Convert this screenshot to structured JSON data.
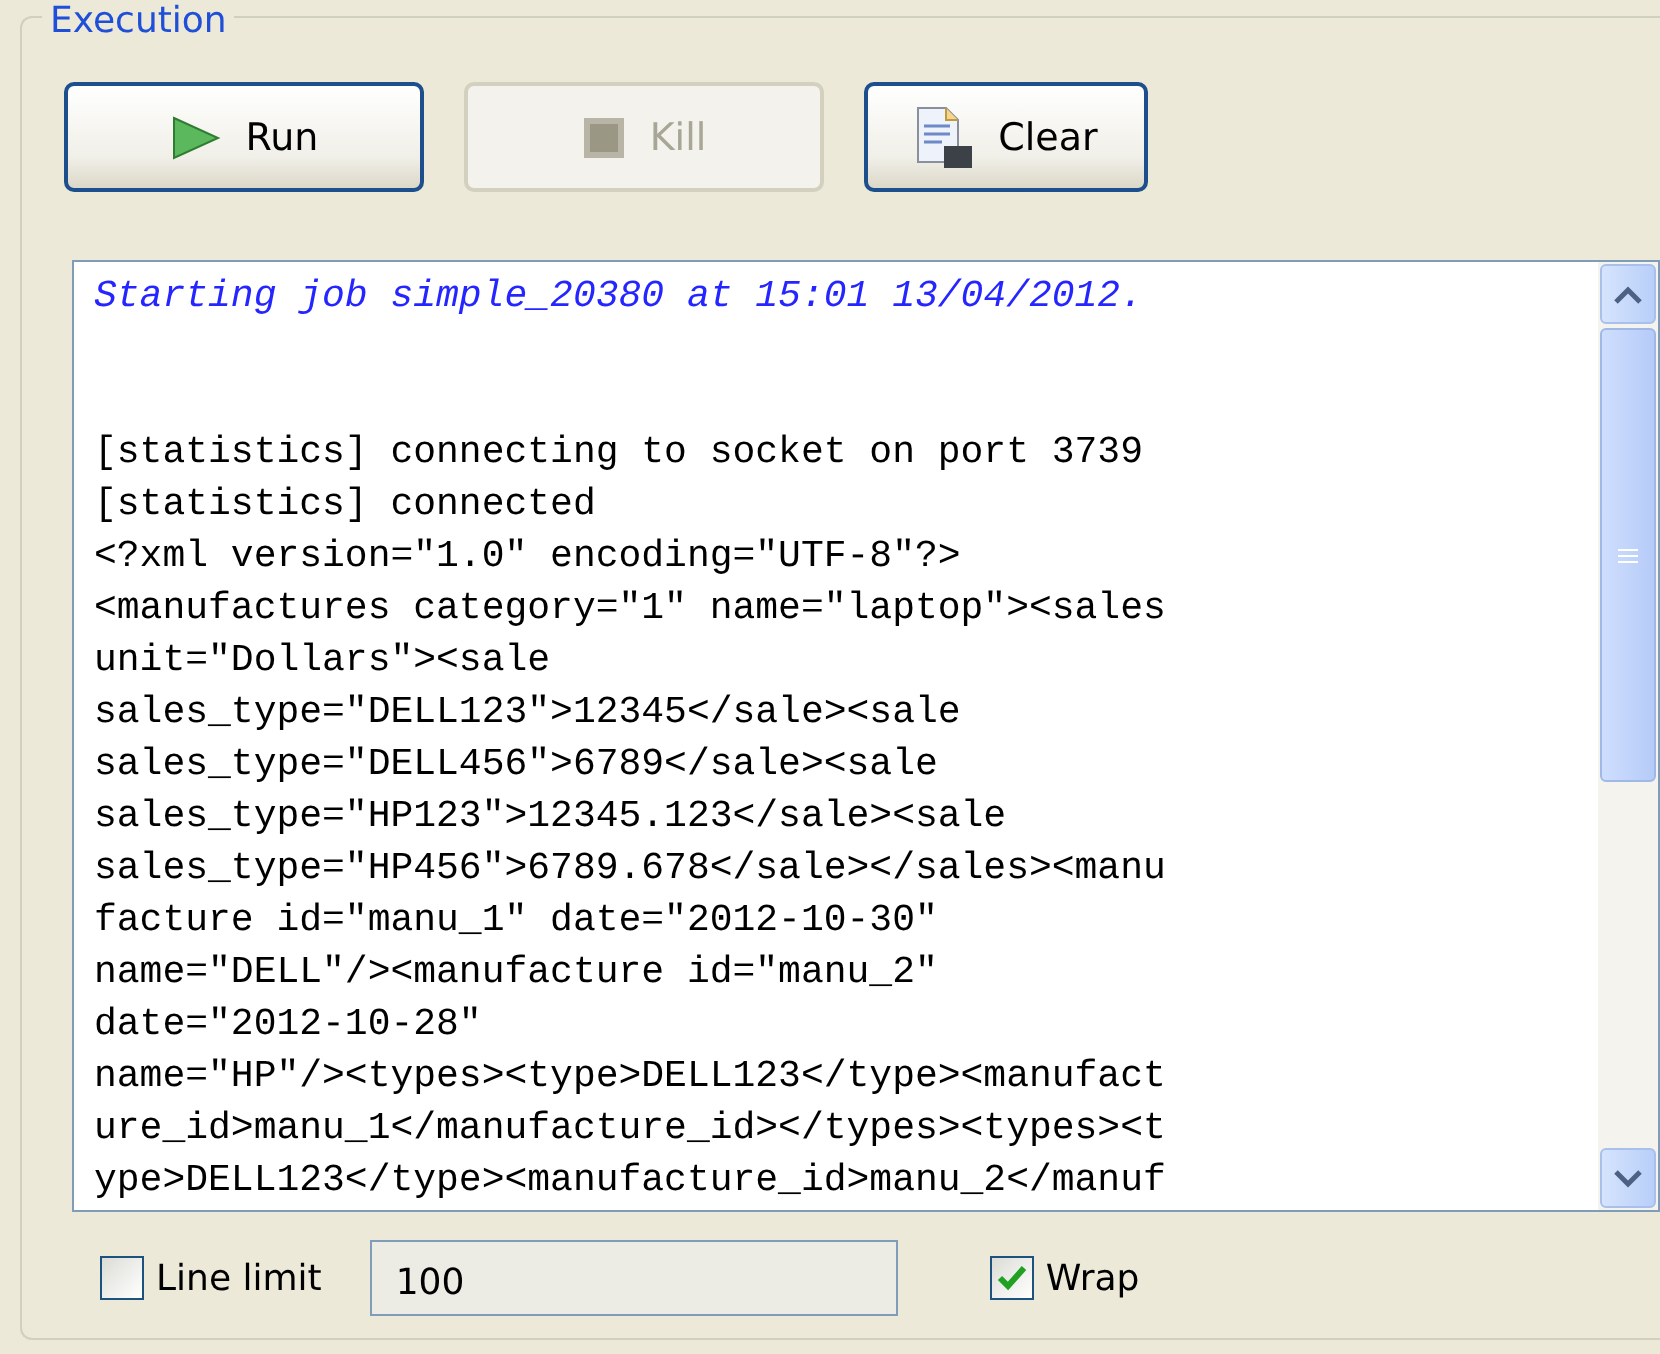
{
  "group": {
    "title": "Execution"
  },
  "buttons": [
    {
      "label": "Run",
      "kind": "run",
      "disabled": false
    },
    {
      "label": "Kill",
      "kind": "kill",
      "disabled": true
    },
    {
      "label": "Clear",
      "kind": "clear",
      "disabled": false
    }
  ],
  "console": {
    "lines": [
      {
        "kind": "info",
        "text": "Starting job simple_20380 at 15:01 13/04/2012."
      },
      {
        "kind": "output",
        "text": "[statistics] connecting to socket on port 3739"
      },
      {
        "kind": "output",
        "text": "[statistics] connected"
      },
      {
        "kind": "output",
        "text": "<?xml version=\"1.0\" encoding=\"UTF-8\"?>"
      },
      {
        "kind": "output",
        "text": "<manufactures category=\"1\" name=\"laptop\"><sales"
      },
      {
        "kind": "output",
        "text": "unit=\"Dollars\"><sale"
      },
      {
        "kind": "output",
        "text": "sales_type=\"DELL123\">12345</sale><sale"
      },
      {
        "kind": "output",
        "text": "sales_type=\"DELL456\">6789</sale><sale"
      },
      {
        "kind": "output",
        "text": "sales_type=\"HP123\">12345.123</sale><sale"
      },
      {
        "kind": "output",
        "text": "sales_type=\"HP456\">6789.678</sale></sales><manu"
      },
      {
        "kind": "output",
        "text": "facture id=\"manu_1\" date=\"2012-10-30\""
      },
      {
        "kind": "output",
        "text": "name=\"DELL\"/><manufacture id=\"manu_2\""
      },
      {
        "kind": "output",
        "text": "date=\"2012-10-28\""
      },
      {
        "kind": "output",
        "text": "name=\"HP\"/><types><type>DELL123</type><manufact"
      },
      {
        "kind": "output",
        "text": "ure_id>manu_1</manufacture_id></types><types><t"
      },
      {
        "kind": "output",
        "text": "ype>DELL123</type><manufacture_id>manu_2</manuf"
      }
    ]
  },
  "line_limit": {
    "label": "Line limit",
    "checked": false,
    "value": "100"
  },
  "wrap": {
    "label": "Wrap",
    "checked": true
  }
}
